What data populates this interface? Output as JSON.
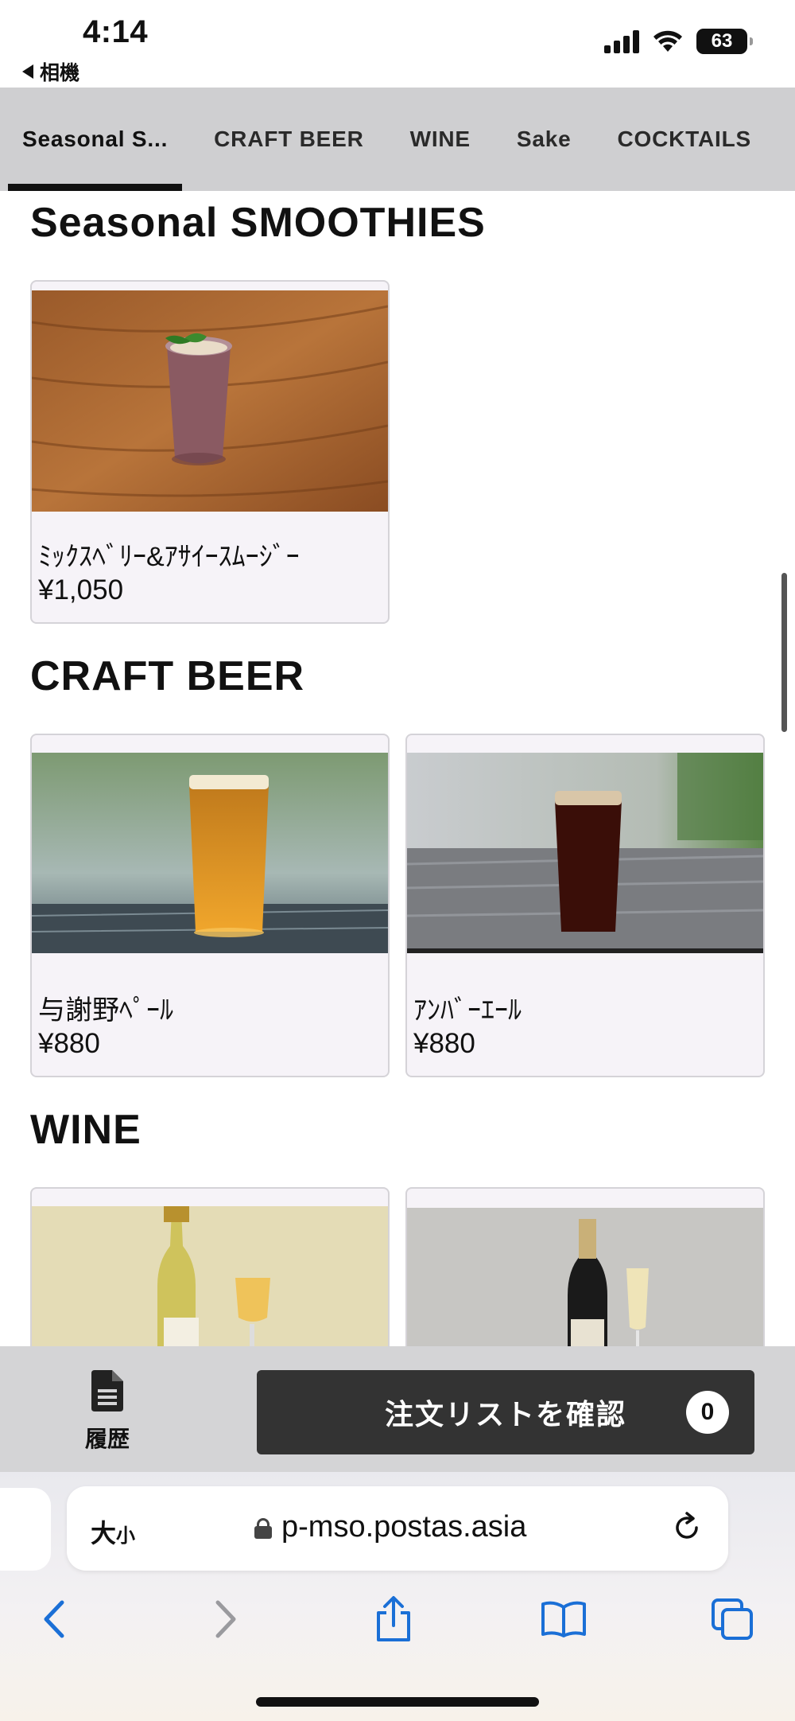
{
  "status_bar": {
    "time": "4:14",
    "back_app": "相機",
    "battery": "63"
  },
  "tabs": [
    {
      "label": "Seasonal S...",
      "active": true
    },
    {
      "label": "CRAFT BEER",
      "active": false
    },
    {
      "label": "WINE",
      "active": false
    },
    {
      "label": "Sake",
      "active": false
    },
    {
      "label": "COCKTAILS",
      "active": false
    }
  ],
  "sections": {
    "smoothies": {
      "title": "Seasonal SMOOTHIES",
      "items": [
        {
          "name": "ﾐｯｸｽﾍﾞﾘｰ&ｱｻｲｰｽﾑｰｼﾞｰ",
          "price": "¥1,050"
        }
      ]
    },
    "craft_beer": {
      "title": "CRAFT BEER",
      "items": [
        {
          "name": "与謝野ﾍﾟｰﾙ",
          "price": "¥880"
        },
        {
          "name": "ｱﾝﾊﾞｰｴｰﾙ",
          "price": "¥880"
        }
      ]
    },
    "wine": {
      "title": "WINE"
    }
  },
  "action_bar": {
    "history_label": "履歴",
    "order_label": "注文リストを確認",
    "order_count": "0"
  },
  "safari": {
    "text_size_label": "大",
    "text_size_small": "小",
    "url": "p-mso.postas.asia"
  },
  "colors": {
    "tab_bar": "#cfcfd1",
    "card_bg": "#f6f3f8",
    "order_button": "#333333",
    "safari_accent": "#1a6fd6"
  }
}
